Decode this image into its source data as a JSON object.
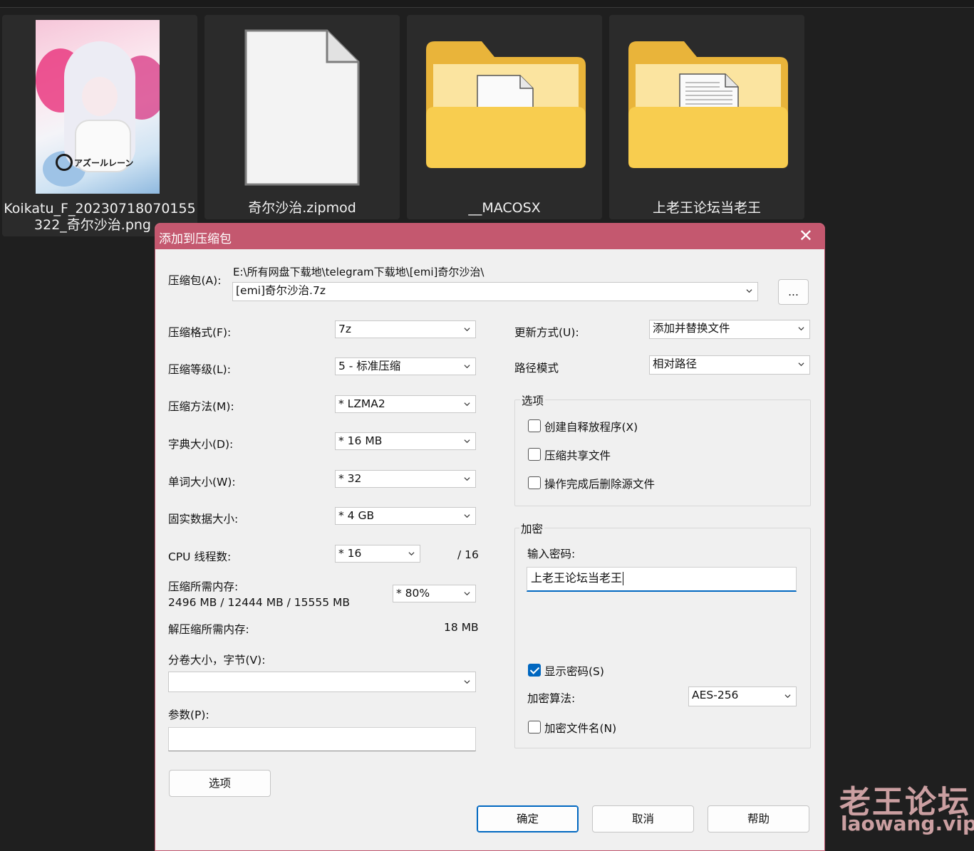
{
  "explorer": {
    "items": [
      {
        "name_line1": "Koikatu_F_20230718070155",
        "name_line2": "322_奇尔沙治.png",
        "kind": "image",
        "thumb_text": "アズールレーン"
      },
      {
        "name_line1": "奇尔沙治.zipmod",
        "kind": "file"
      },
      {
        "name_line1": "__MACOSX",
        "kind": "folder"
      },
      {
        "name_line1": "上老王论坛当老王",
        "kind": "folder"
      }
    ]
  },
  "dialog": {
    "title": "添加到压缩包",
    "close_icon": "✕",
    "archive_label": "压缩包(A):",
    "archive_path": "E:\\所有网盘下载地\\telegram下载地\\[emi]奇尔沙治\\",
    "archive_name": "[emi]奇尔沙治.7z",
    "browse_label": "...",
    "format_label": "压缩格式(F):",
    "format_value": "7z",
    "level_label": "压缩等级(L):",
    "level_value": "5 - 标准压缩",
    "method_label": "压缩方法(M):",
    "method_value": "*  LZMA2",
    "dict_label": "字典大小(D):",
    "dict_value": "*  16 MB",
    "word_label": "单词大小(W):",
    "word_value": "*  32",
    "solid_label": "固实数据大小:",
    "solid_value": "*  4 GB",
    "threads_label": "CPU 线程数:",
    "threads_value": "*  16",
    "threads_total": "/ 16",
    "mem_label": "压缩所需内存:",
    "mem_value": "2496 MB / 12444 MB / 15555 MB",
    "mem_percent": "*  80%",
    "decomp_label": "解压缩所需内存:",
    "decomp_value": "18 MB",
    "volume_label": "分卷大小，字节(V):",
    "volume_value": "",
    "params_label": "参数(P):",
    "params_value": "",
    "options_button": "选项",
    "update_label": "更新方式(U):",
    "update_value": "添加并替换文件",
    "path_label": "路径模式",
    "path_value": "相对路径",
    "options_group": "选项",
    "opt_sfx": "创建自释放程序(X)",
    "opt_shared": "压缩共享文件",
    "opt_delete": "操作完成后删除源文件",
    "encrypt_group": "加密",
    "password_label": "输入密码:",
    "password_value": "上老王论坛当老王",
    "show_password": "显示密码(S)",
    "enc_method_label": "加密算法:",
    "enc_method_value": "AES-256",
    "encrypt_names": "加密文件名(N)",
    "ok": "确定",
    "cancel": "取消",
    "help": "帮助"
  },
  "watermark": {
    "line1": "老王论坛",
    "line2": "laowang.vip"
  },
  "colors": {
    "title_bar": "#c4586f",
    "accent": "#0067c0",
    "folder": "#f8cd4f"
  }
}
